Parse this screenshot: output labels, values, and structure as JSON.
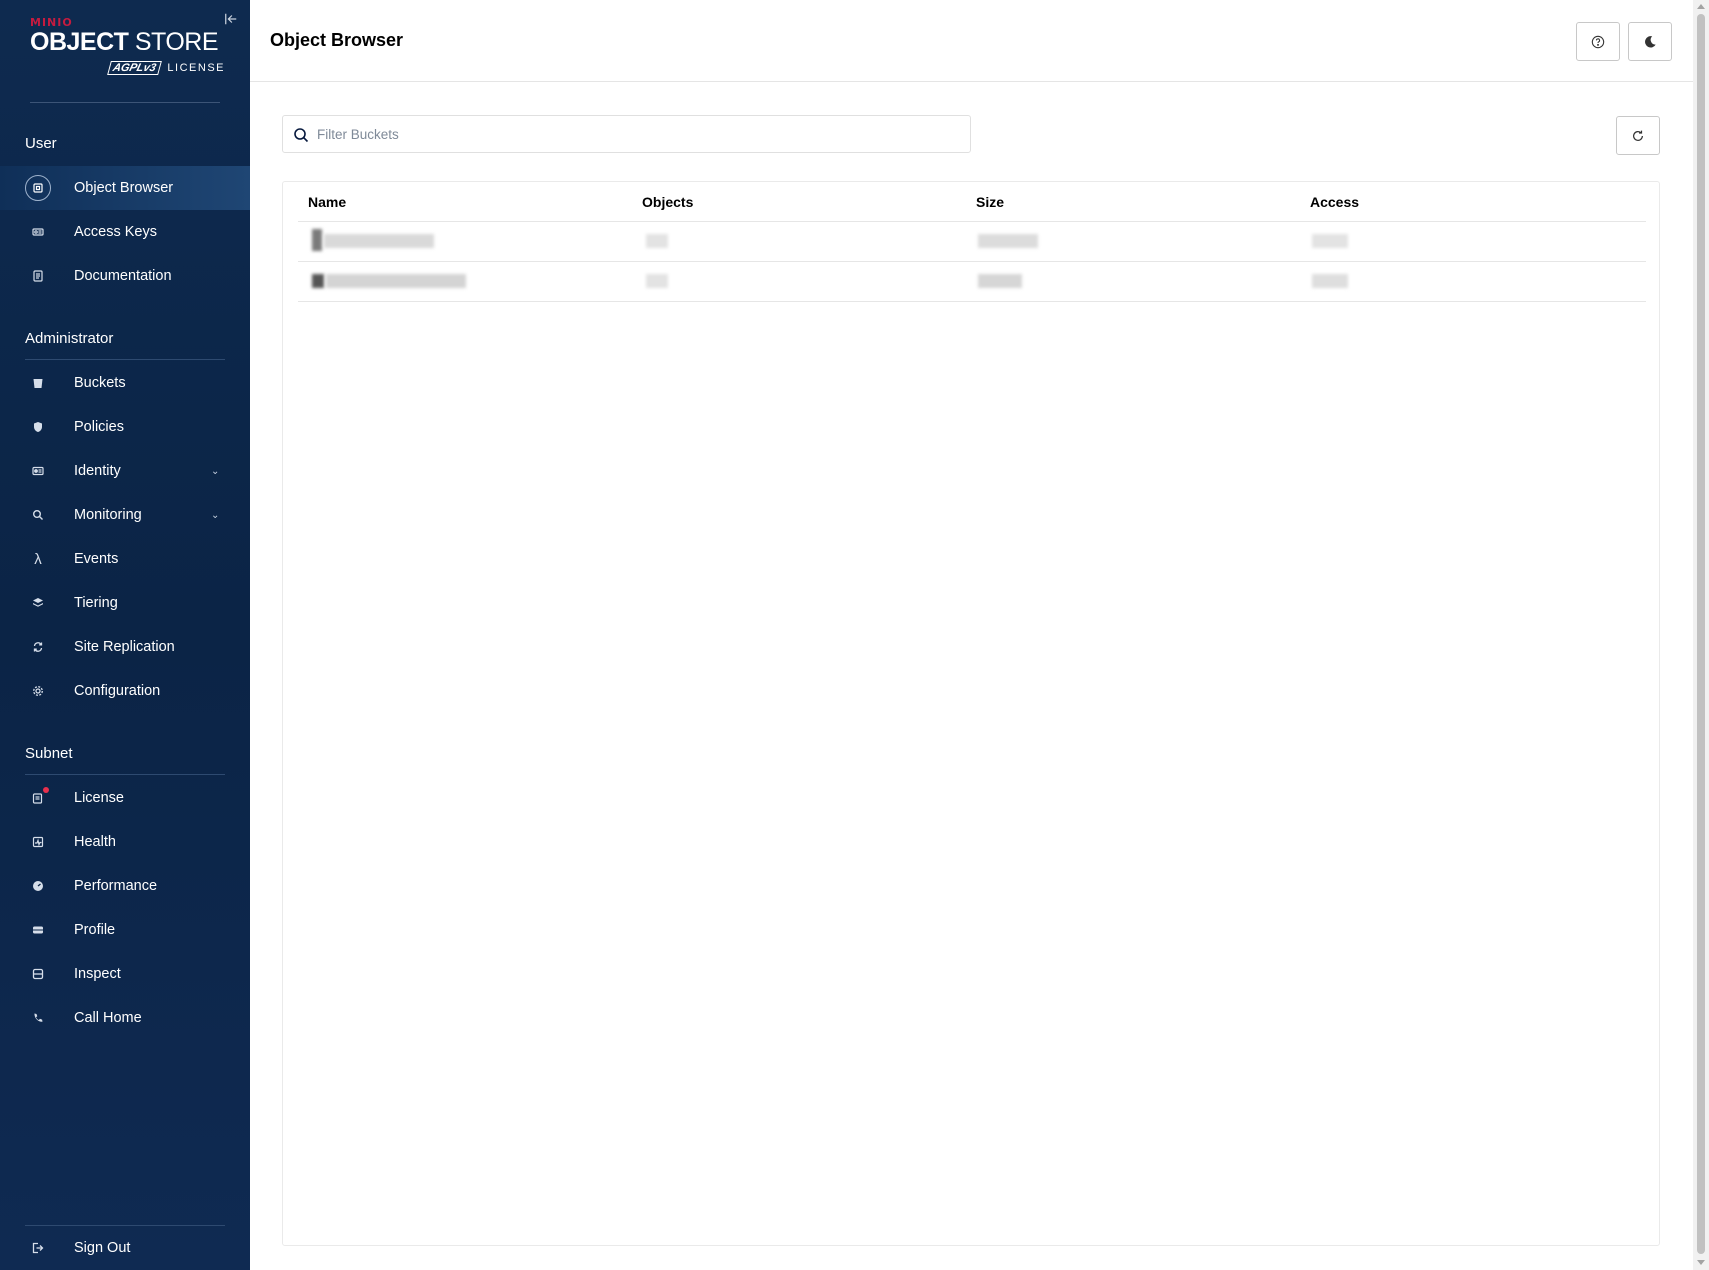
{
  "logo": {
    "vendor": "MINIO",
    "product_bold": "OBJECT",
    "product_light": "STORE",
    "license_badge": "AGPLv3",
    "license_text": "LICENSE"
  },
  "sidebar": {
    "sections": {
      "user": "User",
      "administrator": "Administrator",
      "subnet": "Subnet"
    },
    "user_items": [
      {
        "label": "Object Browser",
        "icon": "object-browser-icon",
        "active": true
      },
      {
        "label": "Access Keys",
        "icon": "access-keys-icon"
      },
      {
        "label": "Documentation",
        "icon": "documentation-icon"
      }
    ],
    "admin_items": [
      {
        "label": "Buckets",
        "icon": "bucket-icon"
      },
      {
        "label": "Policies",
        "icon": "shield-icon"
      },
      {
        "label": "Identity",
        "icon": "id-card-icon",
        "expandable": true
      },
      {
        "label": "Monitoring",
        "icon": "magnifier-icon",
        "expandable": true
      },
      {
        "label": "Events",
        "icon": "lambda-icon"
      },
      {
        "label": "Tiering",
        "icon": "layers-icon"
      },
      {
        "label": "Site Replication",
        "icon": "sync-icon"
      },
      {
        "label": "Configuration",
        "icon": "gear-icon"
      }
    ],
    "subnet_items": [
      {
        "label": "License",
        "icon": "license-icon",
        "notification": true
      },
      {
        "label": "Health",
        "icon": "health-icon"
      },
      {
        "label": "Performance",
        "icon": "gauge-icon"
      },
      {
        "label": "Profile",
        "icon": "profile-icon"
      },
      {
        "label": "Inspect",
        "icon": "inspect-icon"
      },
      {
        "label": "Call Home",
        "icon": "phone-icon"
      }
    ],
    "sign_out": "Sign Out"
  },
  "header": {
    "title": "Object Browser"
  },
  "search": {
    "placeholder": "Filter Buckets"
  },
  "table": {
    "columns": [
      "Name",
      "Objects",
      "Size",
      "Access"
    ]
  },
  "colors": {
    "sidebar_bg": "#0b2446",
    "active_item": "#1f4674",
    "brand_red": "#c51b3f",
    "notification": "#e8304d"
  }
}
